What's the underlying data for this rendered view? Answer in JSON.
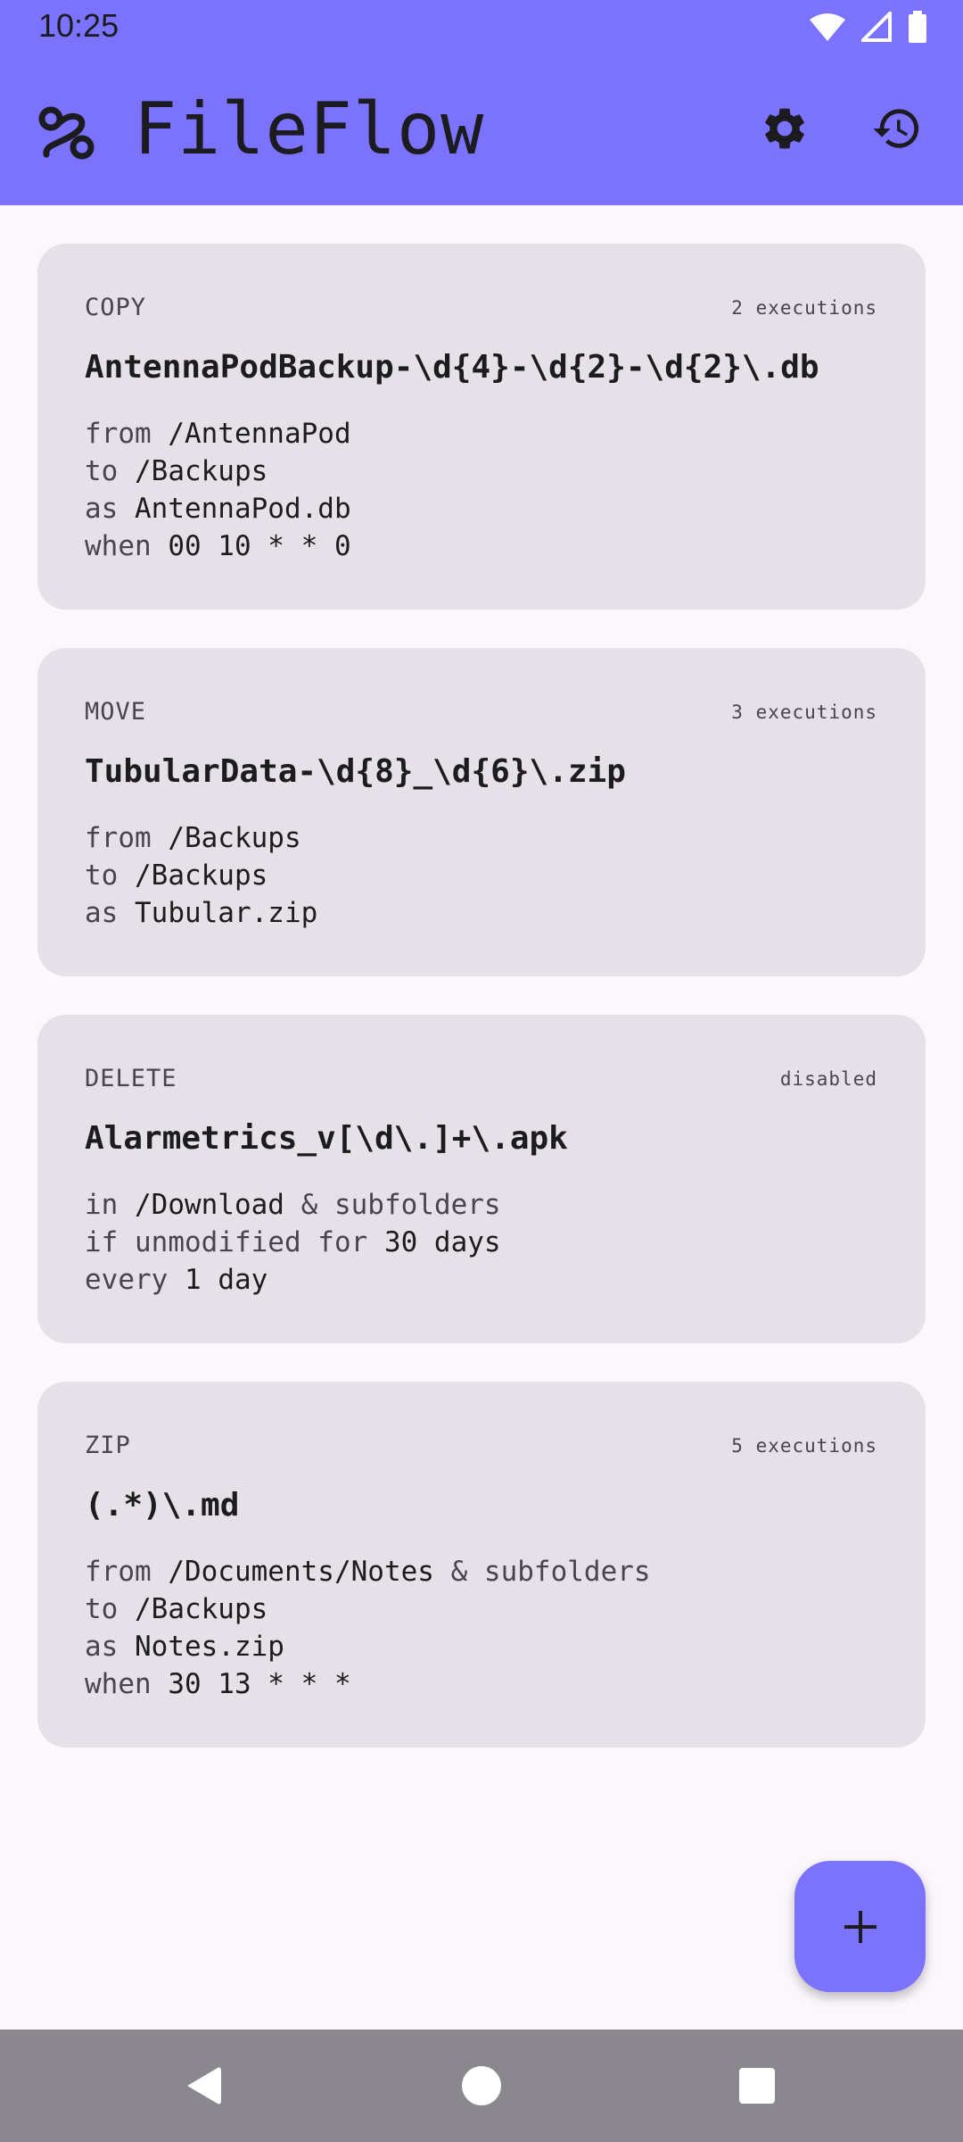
{
  "status": {
    "time": "10:25"
  },
  "app": {
    "title": "FileFlow"
  },
  "icons": {
    "logo": "route-icon",
    "settings": "gear-icon",
    "history": "history-icon",
    "add": "plus-icon",
    "back": "back-triangle-icon",
    "home": "home-circle-icon",
    "recents": "recents-square-icon"
  },
  "colors": {
    "accent": "#7b73fd",
    "card": "#e6e0e8",
    "background": "#fcf7fd"
  },
  "rules": [
    {
      "type": "COPY",
      "meta": "2 executions",
      "pattern": "AntennaPodBackup-\\d{4}-\\d{2}-\\d{2}\\.db",
      "lines": [
        {
          "kw": "from",
          "val": " /AntennaPod",
          "tail": ""
        },
        {
          "kw": "to",
          "val": " /Backups",
          "tail": ""
        },
        {
          "kw": "as",
          "val": " AntennaPod.db",
          "tail": ""
        },
        {
          "kw": "when",
          "val": " 00 10 * * 0",
          "tail": ""
        }
      ]
    },
    {
      "type": "MOVE",
      "meta": "3 executions",
      "pattern": "TubularData-\\d{8}_\\d{6}\\.zip",
      "lines": [
        {
          "kw": "from",
          "val": " /Backups",
          "tail": ""
        },
        {
          "kw": "to",
          "val": " /Backups",
          "tail": ""
        },
        {
          "kw": "as",
          "val": " Tubular.zip",
          "tail": ""
        }
      ]
    },
    {
      "type": "DELETE",
      "meta": "disabled",
      "pattern": "Alarmetrics_v[\\d\\.]+\\.apk",
      "lines": [
        {
          "kw": "in",
          "val": " /Download",
          "tail": " & subfolders"
        },
        {
          "kw": "if unmodified for",
          "val": " 30 days",
          "tail": ""
        },
        {
          "kw": "every",
          "val": " 1 day",
          "tail": ""
        }
      ]
    },
    {
      "type": "ZIP",
      "meta": "5 executions",
      "pattern": "(.*)\\.md",
      "lines": [
        {
          "kw": "from",
          "val": " /Documents/Notes",
          "tail": " & subfolders"
        },
        {
          "kw": "to",
          "val": " /Backups",
          "tail": ""
        },
        {
          "kw": "as",
          "val": " Notes.zip",
          "tail": ""
        },
        {
          "kw": "when",
          "val": " 30 13 * * *",
          "tail": ""
        }
      ]
    }
  ]
}
